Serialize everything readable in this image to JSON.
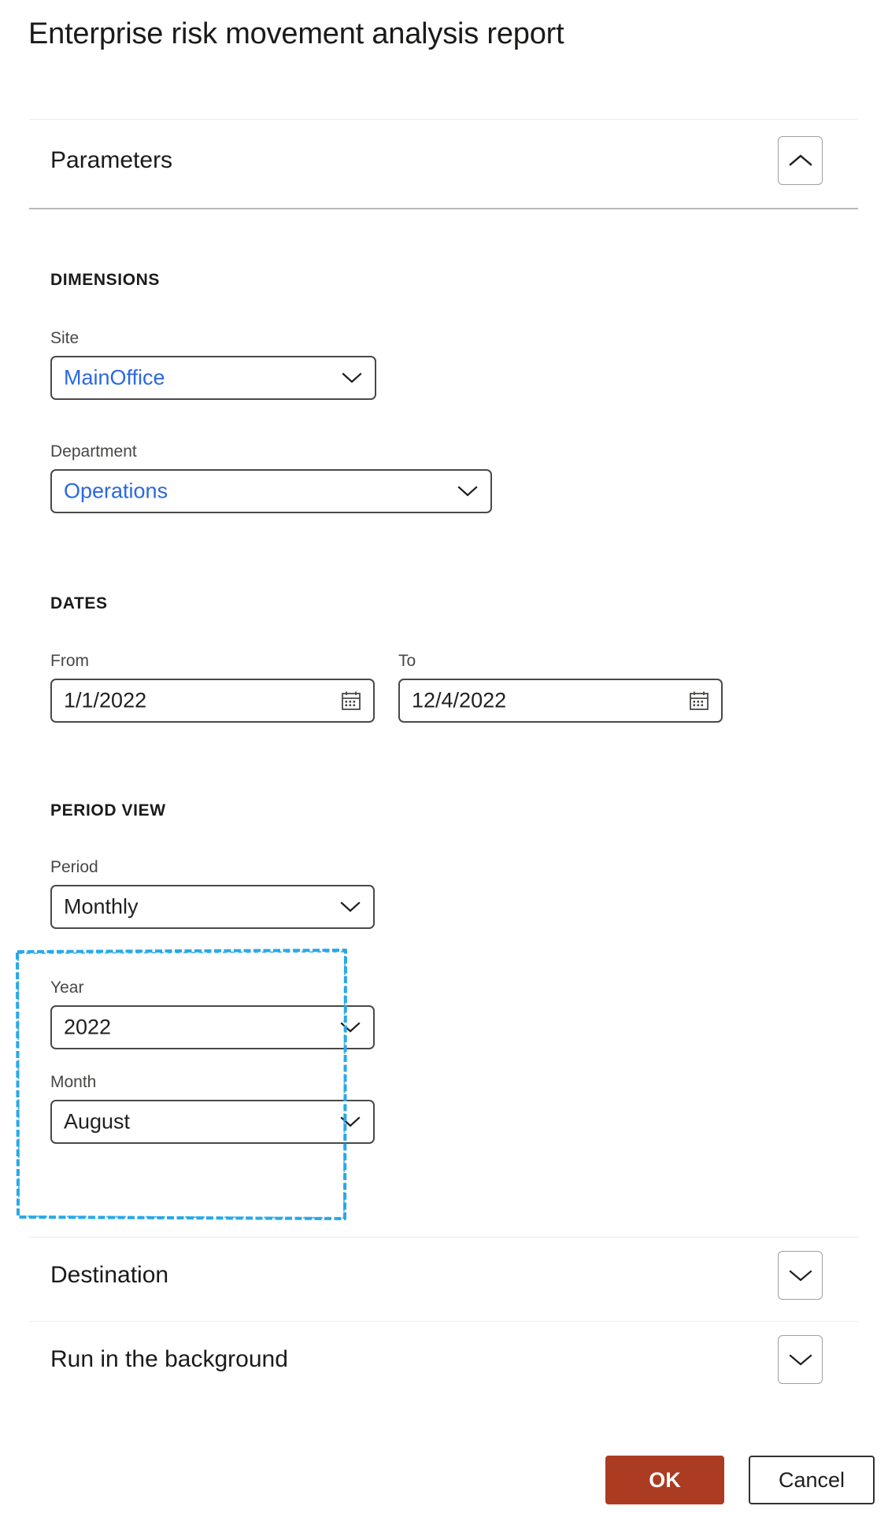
{
  "page": {
    "title": "Enterprise risk movement analysis report"
  },
  "sections": {
    "parameters": {
      "title": "Parameters",
      "toggle_icon": "chevron-up-icon",
      "expanded": true
    },
    "destination": {
      "title": "Destination",
      "toggle_icon": "chevron-down-icon",
      "expanded": false
    },
    "background": {
      "title": "Run in the background",
      "toggle_icon": "chevron-down-icon",
      "expanded": false
    }
  },
  "groups": {
    "dimensions": {
      "heading": "DIMENSIONS",
      "fields": [
        {
          "label": "Site",
          "value": "MainOffice",
          "icon": "chevron-down-icon",
          "style": "link"
        },
        {
          "label": "Department",
          "value": "Operations",
          "icon": "chevron-down-icon",
          "style": "link"
        }
      ]
    },
    "dates": {
      "heading": "DATES",
      "fields": [
        {
          "label": "From",
          "value": "1/1/2022",
          "icon": "calendar-icon",
          "style": "plain"
        },
        {
          "label": "To",
          "value": "12/4/2022",
          "icon": "calendar-icon",
          "style": "plain"
        }
      ]
    },
    "period_view": {
      "heading": "PERIOD VIEW",
      "fields": [
        {
          "label": "Period",
          "value": "Monthly",
          "icon": "chevron-down-icon",
          "style": "plain"
        },
        {
          "label": "Year",
          "value": "2022",
          "icon": "chevron-down-icon",
          "style": "plain"
        },
        {
          "label": "Month",
          "value": "August",
          "icon": "chevron-down-icon",
          "style": "plain"
        }
      ]
    }
  },
  "annotation": {
    "type": "highlight-rectangle",
    "color": "#29a8e8",
    "targets": [
      "Year",
      "Month"
    ]
  },
  "footer": {
    "ok_label": "OK",
    "cancel_label": "Cancel"
  },
  "colors": {
    "accent_primary": "#ac3c21",
    "link": "#2a68e0",
    "annotation": "#29a8e8",
    "border": "#4b4947",
    "divider_light": "#edebe9",
    "divider_strong": "#b9b9b9"
  }
}
